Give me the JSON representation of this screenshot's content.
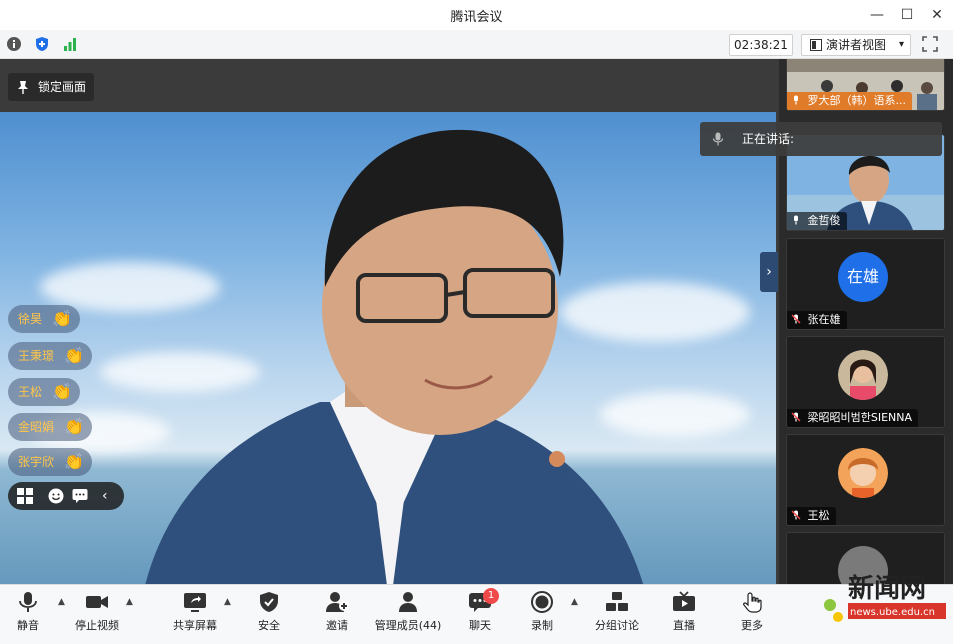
{
  "window": {
    "title": "腾讯会议",
    "minimize": "—",
    "maximize": "☐",
    "close": "✕"
  },
  "infobar": {
    "timer": "02:38:21",
    "view_label": "演讲者视图",
    "view_caret": "▾"
  },
  "stage": {
    "lock_label": "锁定画面",
    "reactions": [
      {
        "name": "徐昊"
      },
      {
        "name": "王秉璟"
      },
      {
        "name": "王松"
      },
      {
        "name": "金昭娟"
      },
      {
        "name": "张宇欣"
      }
    ],
    "collapse_glyph": "›"
  },
  "speaking": {
    "label": "正在讲话:"
  },
  "participants": [
    {
      "name": "罗大部（韩）语系..."
    },
    {
      "name": "金哲俊"
    },
    {
      "name": "张在雄",
      "avatar_text": "在雄"
    },
    {
      "name": "梁昭昭비범한SIENNA"
    },
    {
      "name": "王松"
    }
  ],
  "toolbar": {
    "mute": "静音",
    "stop_video": "停止视频",
    "share_screen": "共享屏幕",
    "security": "安全",
    "invite": "邀请",
    "manage_members": "管理成员(44)",
    "chat": "聊天",
    "chat_badge": "1",
    "record": "录制",
    "breakout": "分组讨论",
    "live": "直播",
    "more": "更多"
  },
  "watermark": {
    "text": "新闻网",
    "url": "news.ube.edu.cn"
  },
  "colors": {
    "accent_blue": "#1e6fe8",
    "reaction_text": "#ffc64a",
    "badge_red": "#f04a4a"
  }
}
